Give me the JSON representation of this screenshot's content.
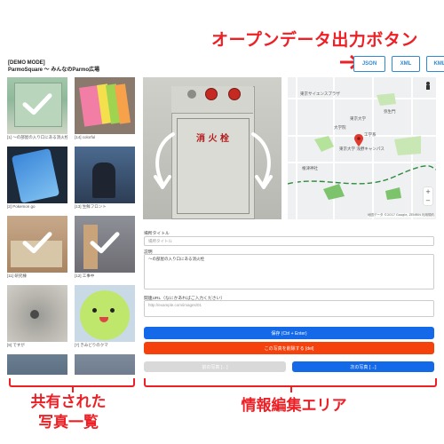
{
  "annotations": {
    "export_callout": "オープンデータ出力ボタン",
    "photos_callout_line1": "共有された",
    "photos_callout_line2": "写真一覧",
    "edit_callout": "情報編集エリア"
  },
  "export_buttons": [
    "JSON",
    "XML",
    "KML"
  ],
  "app": {
    "mode": "[DEMO MODE]",
    "title": "ParmoSquare 〜 みんなのParmo広場"
  },
  "photos": [
    {
      "caption": "[1] ～の部屋の入り口にある消火栓",
      "checked": true
    },
    {
      "caption": "[14] colorful",
      "checked": false
    },
    {
      "caption": "[2] Pokemon go",
      "checked": false
    },
    {
      "caption": "[13] 生鮮フロント",
      "checked": false
    },
    {
      "caption": "[11] 研究棟",
      "checked": true
    },
    {
      "caption": "[12] 工事中",
      "checked": true
    },
    {
      "caption": "[9] ですが",
      "checked": false
    },
    {
      "caption": "[7] きみどりのクマ",
      "checked": false
    }
  ],
  "map": {
    "labels": [
      "東京サイエンスプラザ",
      "弥生門",
      "東京大学",
      "大学院",
      "工学系",
      "東京大学 浅野キャンパス",
      "根津神社"
    ],
    "attribution": "地図データ ©2017 Google, ZENRIN  利用規約"
  },
  "form": {
    "title_label": "場所タイトル",
    "title_placeholder": "場所タイトル",
    "description_label": "説明",
    "description_value": "～の部屋の入り口にある消火栓",
    "url_label": "関連URL（なにかあればご入力ください）",
    "url_placeholder": "http://example.com/images/01"
  },
  "buttons": {
    "save": "保存 (Ctrl + Enter)",
    "delete": "この写真を削除する [del]",
    "prev": "前の写真 [←]",
    "next": "次の写真 [→]"
  },
  "colors": {
    "accent_red": "#ee1f25",
    "primary_blue": "#1469e8",
    "danger_orange": "#f5410b",
    "disabled_gray": "#d9d9d9"
  }
}
